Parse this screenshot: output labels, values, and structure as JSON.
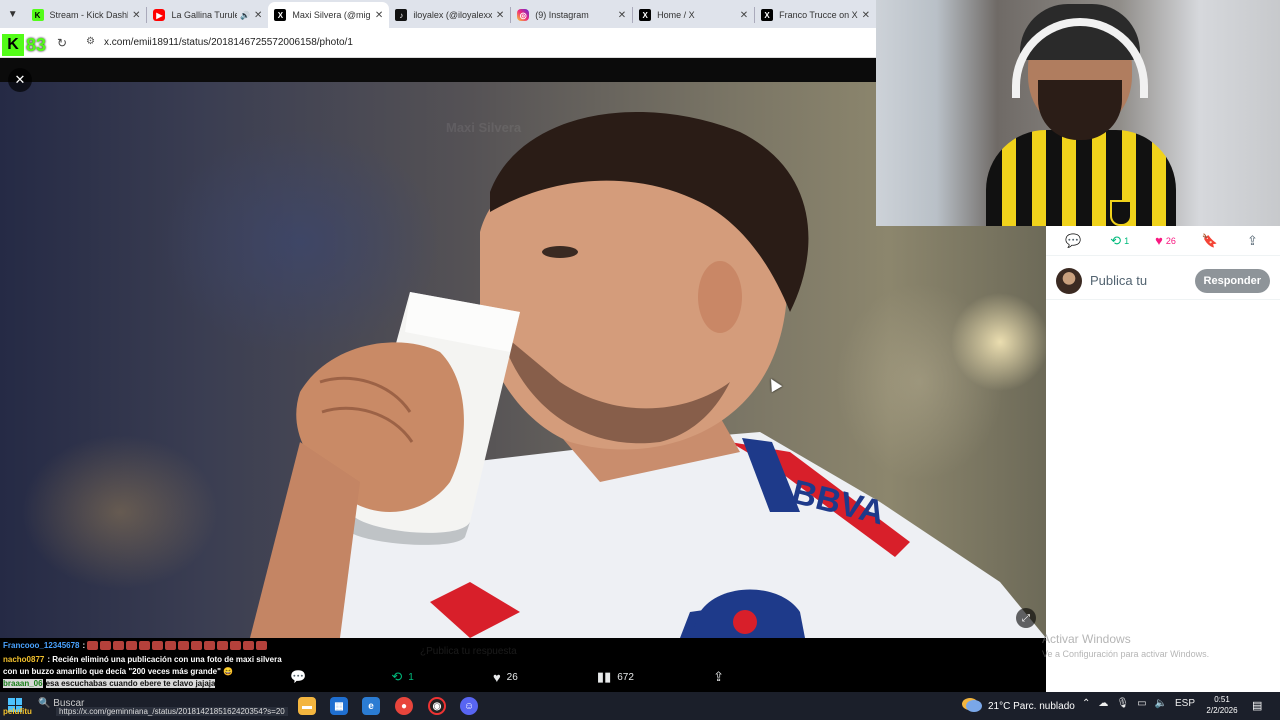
{
  "browser": {
    "tabs": [
      {
        "label": "Stream - Kick Dashbo",
        "favicon": "kick-icon",
        "active": false
      },
      {
        "label": "La Gallina Turuleca",
        "favicon": "youtube-icon",
        "active": false,
        "audio": true
      },
      {
        "label": "Maxi Silvera (@migu",
        "favicon": "x-icon",
        "active": true
      },
      {
        "label": "iloyalex (@iloyalexx)",
        "favicon": "tiktok-icon",
        "active": false
      },
      {
        "label": "(9) Instagram",
        "favicon": "instagram-icon",
        "active": false
      },
      {
        "label": "Home / X",
        "favicon": "x-icon",
        "active": false
      },
      {
        "label": "Franco Trucce on X: \"",
        "favicon": "x-icon",
        "active": false
      }
    ],
    "url": "x.com/emii18911/status/2018146725572006158/photo/1",
    "kick_viewer_count": "83"
  },
  "viewer": {
    "ghost_header": "Maxi Silvera",
    "close_label": "✕",
    "actions": {
      "reply_count": "",
      "retweet_count": "1",
      "like_count": "26",
      "view_count": "672"
    },
    "ghost_reply": "¿Publica tu respuesta"
  },
  "side_panel": {
    "retweet_count": "1",
    "like_count": "26",
    "reply_placeholder": "Publica tu",
    "reply_button": "Responder"
  },
  "watermark": {
    "line1": "Activar Windows",
    "line2": "Ve a Configuración para activar Windows."
  },
  "chat": {
    "messages": [
      {
        "user": "Francooo_12345678",
        "user_color": "#4aa3ff",
        "text": "",
        "emotes": 14
      },
      {
        "user": "nacho0877",
        "user_color": "#f3c12c",
        "text": "Recién eliminó una publicación con una foto de maxi silvera con un buzzo amarillo que decía \"200 veces más grande\" 😄"
      },
      {
        "user": "braaan_06",
        "user_color": "#53fc18",
        "text": "esa escuchabas cuando ebere te clavo jajaja"
      }
    ],
    "status_url": "https://x.com/geminniana_/status/2018142185162420354?s=20",
    "footer_user": "pelufitu"
  },
  "taskbar": {
    "search": "Buscar",
    "weather": "21°C  Parc. nublado",
    "language": "ESP",
    "time": "0:51",
    "date": "2/2/2026"
  },
  "colors": {
    "accent_green": "#00ba7c",
    "like_pink": "#f91880",
    "kick_green": "#53fc18"
  }
}
